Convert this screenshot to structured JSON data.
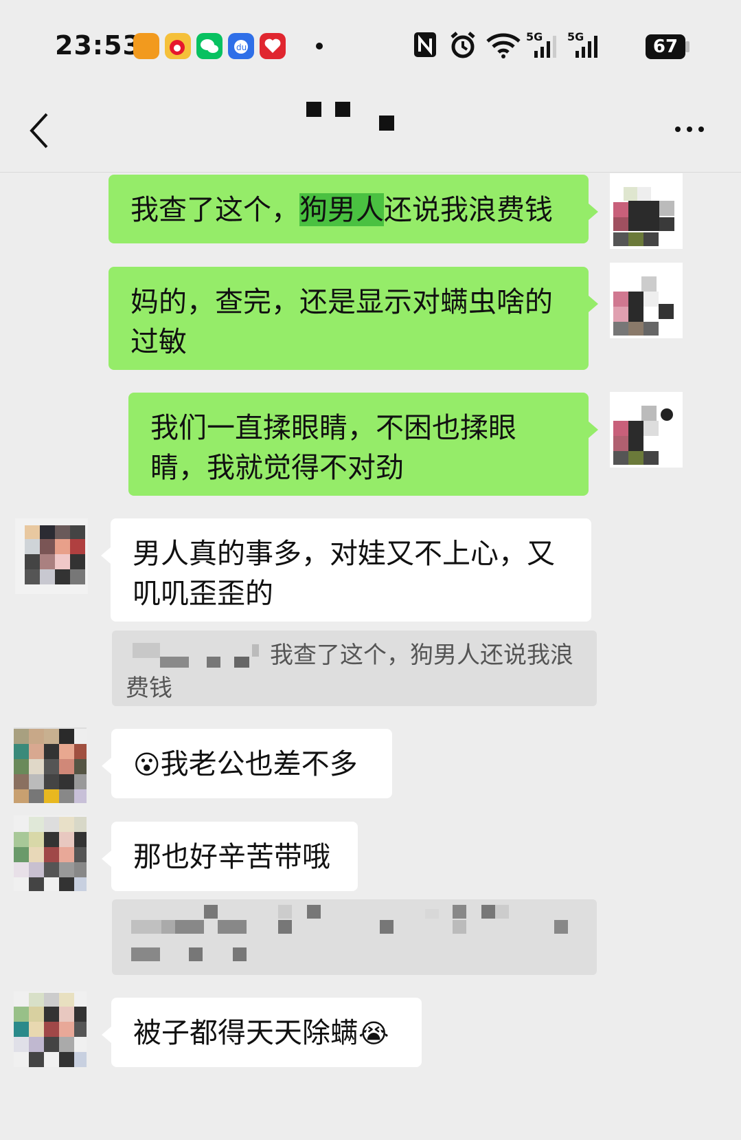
{
  "status_bar": {
    "time": "23:53",
    "app_icons": [
      "imou-app-icon",
      "weibo-icon",
      "wechat-icon",
      "baidu-icon",
      "red-app-icon"
    ],
    "signal_labels": [
      "5G",
      "5G"
    ],
    "battery": "67",
    "system_icons": [
      "nfc-icon",
      "alarm-icon",
      "wifi-icon",
      "signal-icon",
      "signal-icon",
      "battery-icon"
    ]
  },
  "header": {
    "title": "",
    "back_icon": "chevron-left-icon",
    "more_icon": "more-dots-icon"
  },
  "messages": [
    {
      "sender": "me",
      "text_before": "我查了这个，",
      "highlight": "狗男人",
      "text_after": "还说我浪费钱"
    },
    {
      "sender": "me",
      "text": "妈的，查完，还是显示对螨虫啥的过敏"
    },
    {
      "sender": "me",
      "text": "我们一直揉眼睛，不困也揉眼睛，我就觉得不对劲"
    },
    {
      "sender": "other",
      "text": "男人真的事多，对娃又不上心，又叽叽歪歪的",
      "quote": {
        "text": "我查了这个，狗男人还说我浪费钱"
      }
    },
    {
      "sender": "other",
      "emoji": "😮",
      "text": "我老公也差不多"
    },
    {
      "sender": "other",
      "text": "那也好辛苦带哦",
      "quote_redacted": true
    },
    {
      "sender": "other",
      "text": "被子都得天天除螨",
      "emoji_after": "😭"
    }
  ],
  "colors": {
    "background": "#ededed",
    "my_bubble": "#95ec69",
    "other_bubble": "#ffffff",
    "highlight": "#4ac141",
    "quote_bg": "#dedede"
  }
}
